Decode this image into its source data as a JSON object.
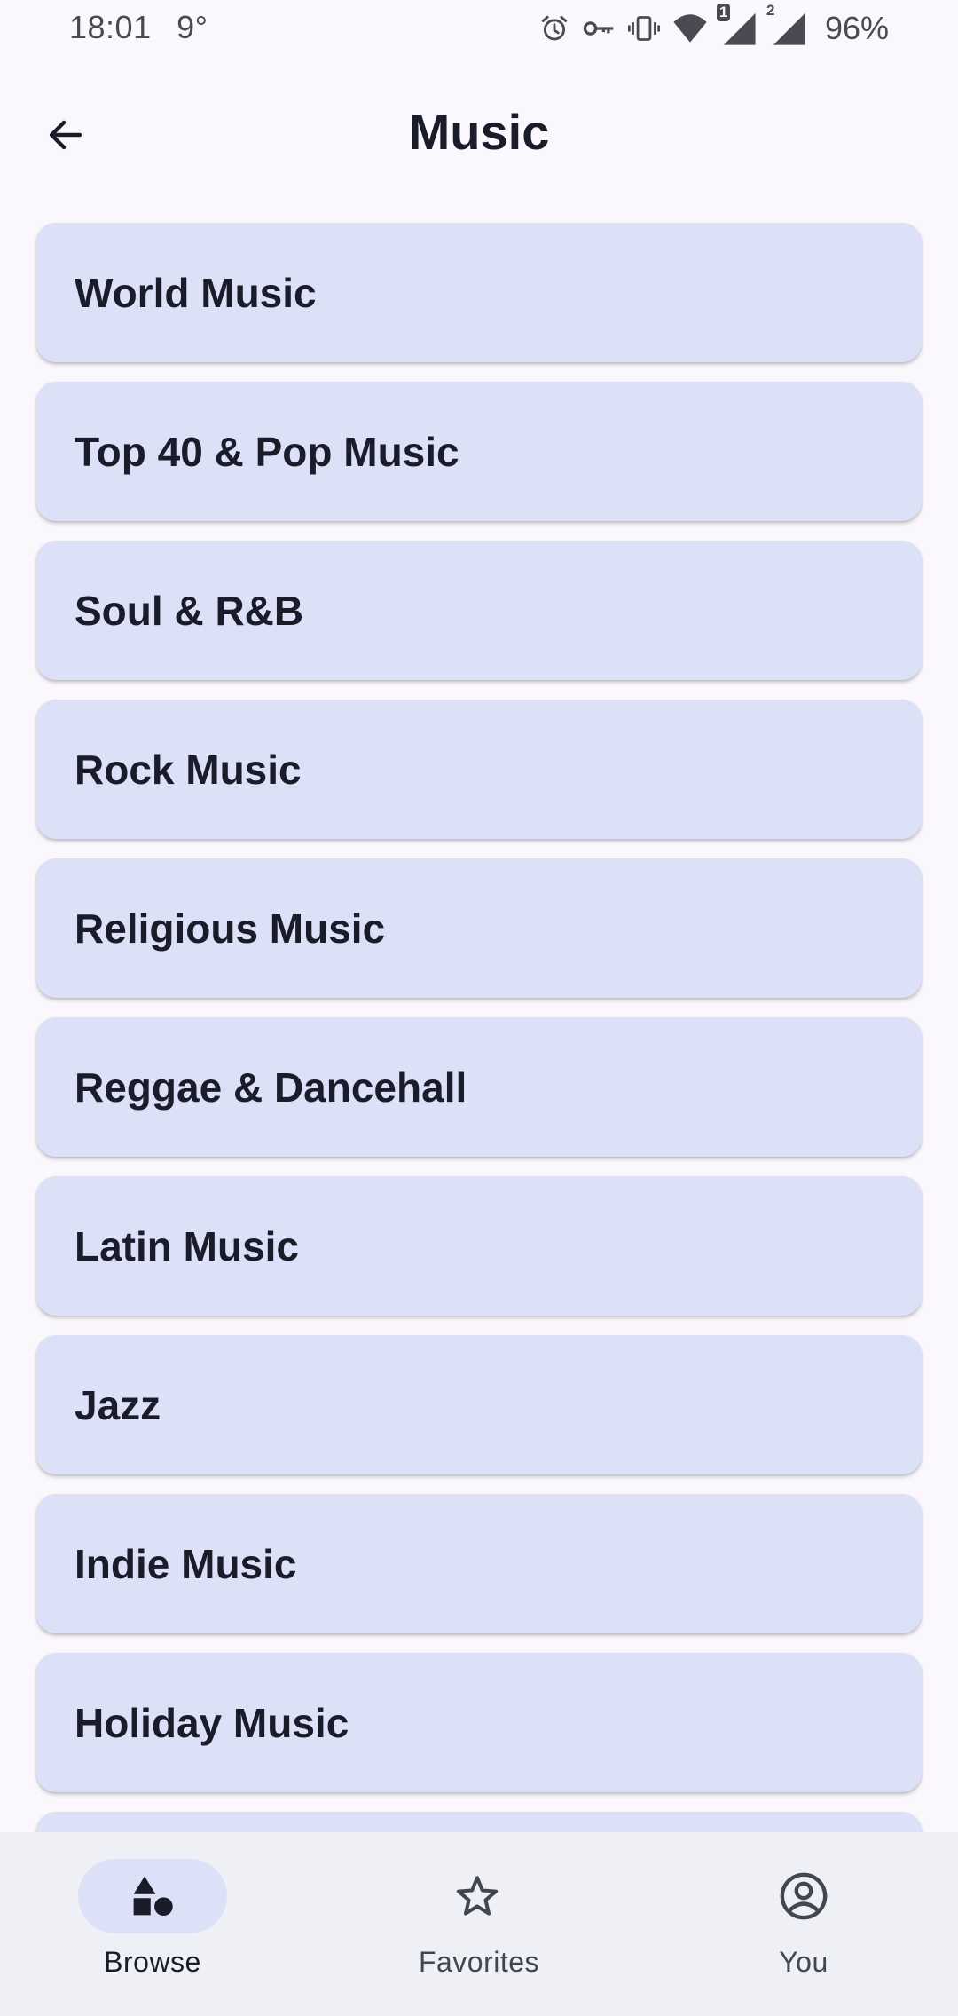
{
  "status_bar": {
    "time": "18:01",
    "temperature": "9°",
    "icons": [
      "alarm-icon",
      "vpn-key-icon",
      "vibrate-icon",
      "wifi-icon",
      "signal-sim1-icon",
      "signal-sim2-icon"
    ],
    "sim1_badge": "1",
    "sim2_badge": "2",
    "battery": "96%"
  },
  "app_bar": {
    "title": "Music",
    "back_icon": "arrow-back-icon"
  },
  "list": {
    "items": [
      {
        "label": "World Music"
      },
      {
        "label": "Top 40 & Pop Music"
      },
      {
        "label": "Soul & R&B"
      },
      {
        "label": "Rock Music"
      },
      {
        "label": "Religious Music"
      },
      {
        "label": "Reggae & Dancehall"
      },
      {
        "label": "Latin Music"
      },
      {
        "label": "Jazz"
      },
      {
        "label": "Indie Music"
      },
      {
        "label": "Holiday Music"
      },
      {
        "label": ""
      }
    ]
  },
  "bottom_nav": {
    "items": [
      {
        "label": "Browse",
        "icon": "shapes-icon",
        "selected": true
      },
      {
        "label": "Favorites",
        "icon": "star-outline-icon",
        "selected": false
      },
      {
        "label": "You",
        "icon": "account-circle-icon",
        "selected": false
      }
    ]
  },
  "colors": {
    "background": "#fbf8fd",
    "card": "#dce1f8",
    "text": "#1a1c2a",
    "nav_background": "#efeff6",
    "nav_indicator": "#dce1f8"
  }
}
